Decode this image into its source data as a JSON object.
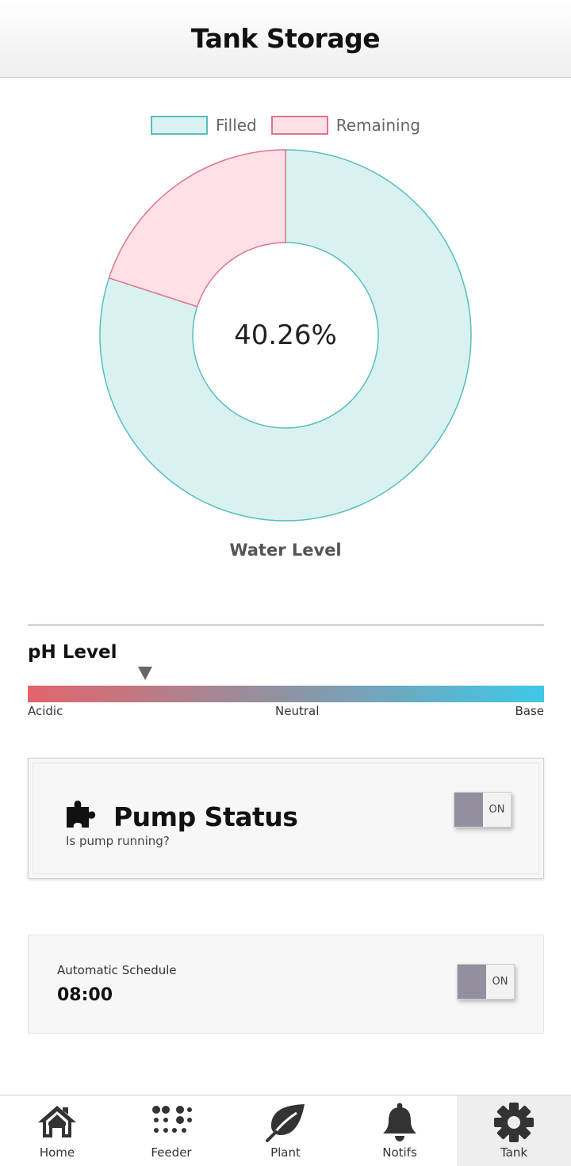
{
  "header": {
    "title": "Tank Storage"
  },
  "legend": {
    "filled_label": "Filled",
    "remaining_label": "Remaining"
  },
  "chart_data": {
    "type": "pie",
    "variant": "doughnut",
    "title": "Water Level",
    "center_label": "40.26%",
    "slices": [
      {
        "label": "Filled",
        "value": 80,
        "color": "#daf1f1",
        "stroke": "#55bfbf"
      },
      {
        "label": "Remaining",
        "value": 20,
        "color": "#ffe0e6",
        "stroke": "#e2728c"
      }
    ],
    "legend_position": "top"
  },
  "ph": {
    "title": "pH Level",
    "labels": {
      "acidic": "Acidic",
      "neutral": "Neutral",
      "base": "Base"
    },
    "marker_fraction": 0.227,
    "colors": {
      "acidic": "#e4646b",
      "neutral": "#8f93a3",
      "base": "#3ec8e8"
    }
  },
  "pump": {
    "title": "Pump Status",
    "subtitle": "Is pump running?",
    "icon": "puzzle-icon",
    "toggle_label": "ON"
  },
  "schedule": {
    "label": "Automatic Schedule",
    "time": "08:00",
    "toggle_label": "ON"
  },
  "nav": {
    "items": [
      {
        "label": "Home",
        "icon": "home-icon"
      },
      {
        "label": "Feeder",
        "icon": "dots-grid-icon"
      },
      {
        "label": "Plant",
        "icon": "leaf-icon"
      },
      {
        "label": "Notifs",
        "icon": "bell-icon"
      },
      {
        "label": "Tank",
        "icon": "gear-icon",
        "active": true
      }
    ]
  }
}
